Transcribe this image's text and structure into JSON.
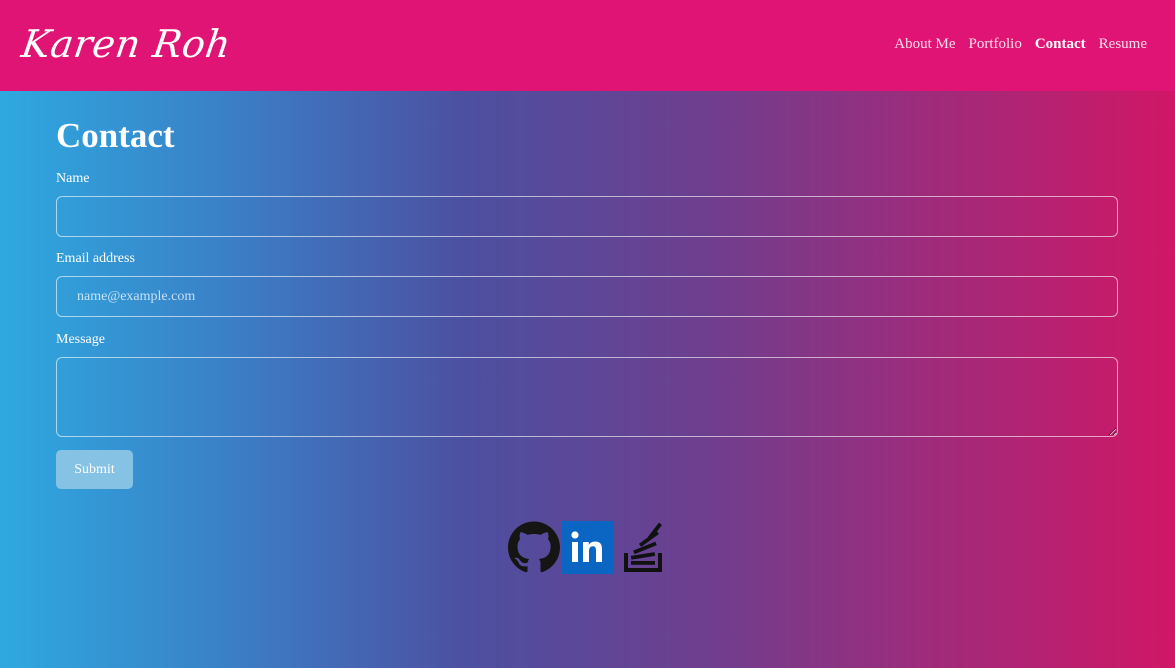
{
  "nav": {
    "brand": "Karen Roh",
    "links": [
      {
        "label": "About Me",
        "active": false
      },
      {
        "label": "Portfolio",
        "active": false
      },
      {
        "label": "Contact",
        "active": true
      },
      {
        "label": "Resume",
        "active": false
      }
    ]
  },
  "page": {
    "title": "Contact"
  },
  "form": {
    "name_label": "Name",
    "name_value": "",
    "email_label": "Email address",
    "email_placeholder": "name@example.com",
    "email_value": "",
    "message_label": "Message",
    "message_value": "",
    "submit_label": "Submit"
  },
  "social": {
    "icons": [
      "github-icon",
      "linkedin-icon",
      "stackoverflow-icon"
    ]
  },
  "colors": {
    "navbar": "#e01474",
    "gradient_start": "#2ea9df",
    "gradient_end": "#d01766",
    "submit_button": "#86c2e4",
    "linkedin_blue": "#0a66c2"
  }
}
